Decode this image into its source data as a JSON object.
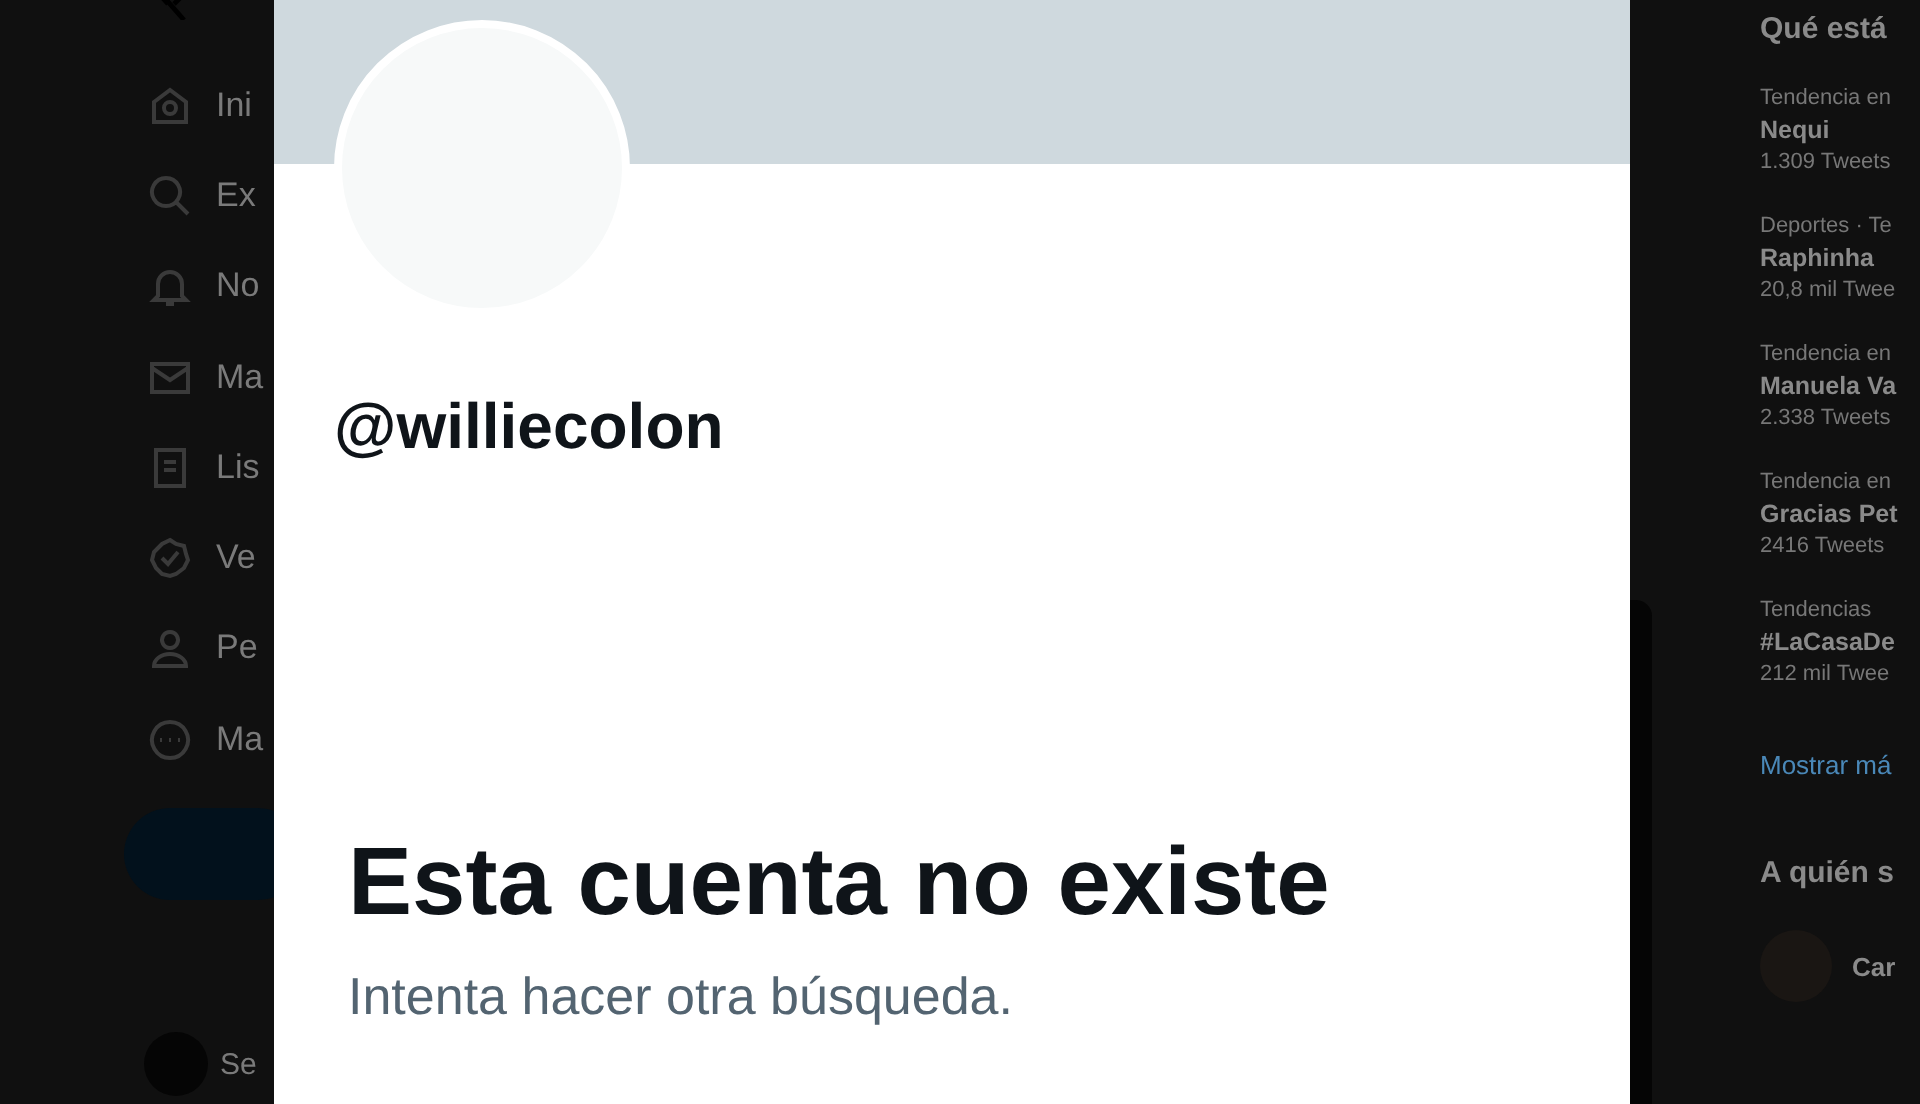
{
  "sidebar": {
    "items": [
      {
        "label": "Ini"
      },
      {
        "label": "Ex"
      },
      {
        "label": "No"
      },
      {
        "label": "Ma"
      },
      {
        "label": "Lis"
      },
      {
        "label": "Ve"
      },
      {
        "label": "Pe"
      },
      {
        "label": "Ma"
      }
    ],
    "account": {
      "label": "Se"
    }
  },
  "profile": {
    "handle": "@williecolon",
    "title": "Esta cuenta no existe",
    "message": "Intenta hacer otra búsqueda."
  },
  "trends": {
    "heading": "Qué está",
    "items": [
      {
        "context": "Tendencia en",
        "name": "Nequi",
        "count": "1.309 Tweets"
      },
      {
        "context": "Deportes · Te",
        "name": "Raphinha",
        "count": "20,8 mil Twee"
      },
      {
        "context": "Tendencia en",
        "name": "Manuela Va",
        "count": "2.338 Tweets"
      },
      {
        "context": "Tendencia en",
        "name": "Gracias Pet",
        "count": "2416 Tweets"
      },
      {
        "context": "Tendencias",
        "name": "#LaCasaDe",
        "count": "212 mil Twee"
      }
    ],
    "show_more": "Mostrar má"
  },
  "who_to_follow": {
    "heading": "A quién s",
    "suggestion": "Car"
  }
}
